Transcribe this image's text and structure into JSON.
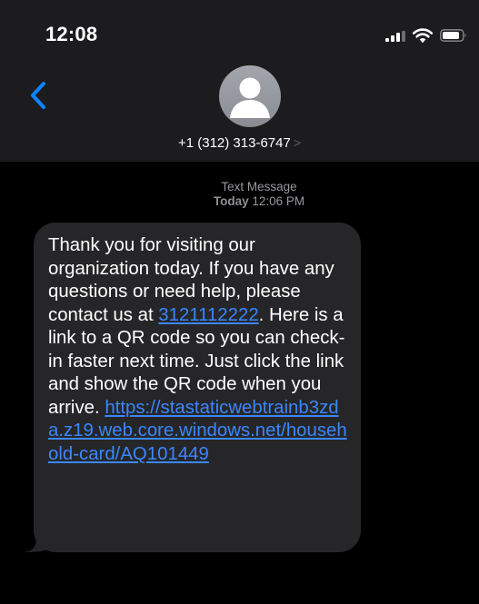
{
  "status_bar": {
    "time": "12:08",
    "signal_icon": "cellular-signal-icon",
    "wifi_icon": "wifi-icon",
    "battery_icon": "battery-icon"
  },
  "header": {
    "back_icon": "chevron-left-icon",
    "avatar_icon": "person-silhouette-icon",
    "contact_number": "+1 (312) 313-6747",
    "contact_chevron": ">"
  },
  "conversation": {
    "service_label": "Text Message",
    "timestamp_day": "Today",
    "timestamp_time": "12:06 PM"
  },
  "message": {
    "text_1": "Thank you for visiting our organization today. If you have any questions or need help, please contact us at ",
    "phone_link": "3121112222",
    "text_2": ". Here is a link to a QR code so you can check-in faster next time. Just click the link and show the QR code when you arrive. ",
    "url_link": "https://stastaticwebtrainb3zda.z19.web.core.windows.net/household-card/AQ101449"
  },
  "colors": {
    "header_bg": "#1c1c1e",
    "screen_bg": "#000000",
    "bubble_bg": "#262628",
    "link": "#3a87ff",
    "ios_blue": "#0a84ff"
  }
}
